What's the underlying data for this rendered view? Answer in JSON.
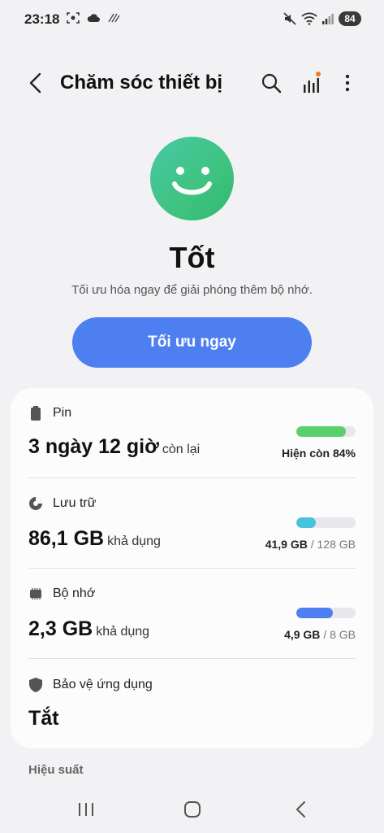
{
  "status_bar": {
    "time": "23:18",
    "battery_level": "84"
  },
  "app_bar": {
    "title": "Chăm sóc thiết bị"
  },
  "hero": {
    "status": "Tốt",
    "subtitle": "Tối ưu hóa ngay để giải phóng thêm bộ nhớ.",
    "optimize_label": "Tối ưu ngay"
  },
  "metrics": {
    "battery": {
      "label": "Pin",
      "value": "3 ngày 12 giờ",
      "unit": "còn lại",
      "caption": "Hiện còn 84%",
      "level": 0.84,
      "color": "#5ad06a"
    },
    "storage": {
      "label": "Lưu trữ",
      "value": "86,1 GB",
      "unit": "khả dụng",
      "used": "41,9 GB",
      "separator": "/",
      "total": "128 GB",
      "level": 0.327,
      "color": "#47c4dc"
    },
    "memory": {
      "label": "Bộ nhớ",
      "value": "2,3 GB",
      "unit": "khả dụng",
      "used": "4,9 GB",
      "separator": "/",
      "total": "8 GB",
      "level": 0.6125,
      "color": "#4e7ff1"
    },
    "app_protection": {
      "label": "Bảo vệ ứng dụng",
      "value": "Tắt"
    }
  },
  "sections": {
    "performance": "Hiệu suất"
  }
}
